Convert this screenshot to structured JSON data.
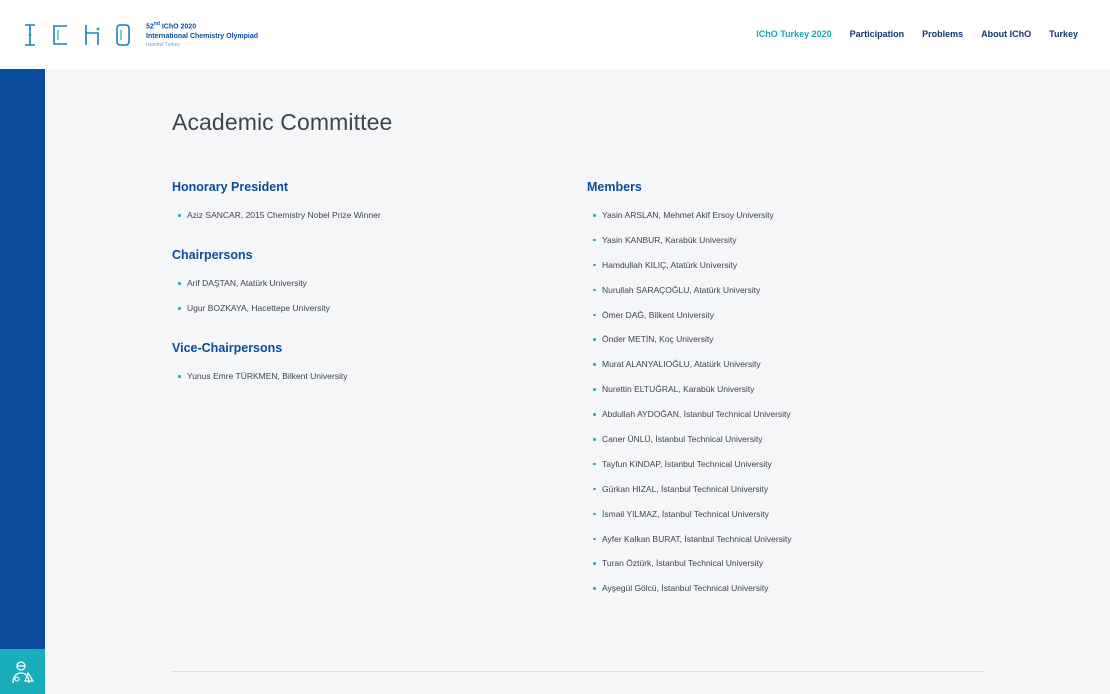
{
  "header": {
    "logo": {
      "letters": [
        "I",
        "C",
        "h",
        "O"
      ],
      "edition": "52",
      "edition_suffix": "nd",
      "event": "IChO 2020",
      "name": "International Chemistry Olympiad",
      "location": "Istanbul Turkey"
    },
    "nav": [
      {
        "label": "IChO Turkey 2020",
        "active": true
      },
      {
        "label": "Participation",
        "active": false
      },
      {
        "label": "Problems",
        "active": false
      },
      {
        "label": "About IChO",
        "active": false
      },
      {
        "label": "Turkey",
        "active": false
      }
    ]
  },
  "main": {
    "title": "Academic Committee",
    "left": [
      {
        "heading": "Honorary President",
        "items": [
          "Aziz SANCAR, 2015 Chemistry Nobel Prize Winner"
        ]
      },
      {
        "heading": "Chairpersons",
        "items": [
          "Arif DAŞTAN, Atatürk University",
          "Ugur BOZKAYA, Hacettepe University"
        ]
      },
      {
        "heading": "Vice-Chairpersons",
        "items": [
          "Yunus Emre TÜRKMEN, Bilkent University"
        ]
      }
    ],
    "right": {
      "heading": "Members",
      "items": [
        "Yasin ARSLAN, Mehmet Akif Ersoy University",
        "Yasin KANBUR, Karabük University",
        "Hamdullah KILIÇ, Atatürk University",
        "Nurullah SARAÇOĞLU, Atatürk University",
        "Ömer DAĞ, Bilkent University",
        "Önder METİN, Koç University",
        "Murat ALANYALIOĞLU, Atatürk University",
        "Nurettin ELTUĞRAL, Karabük University",
        "Abdullah AYDOĞAN, İstanbul Technical University",
        "Caner ÜNLÜ, İstanbul Technical University",
        "Tayfun KINDAP, İstanbul Technical University",
        "Gürkan HIZAL, İstanbul Technical University",
        "İsmail YILMAZ, İstanbul Technical University",
        "Ayfer Kalkan BURAT, İstanbul Technical University",
        "Turan Öztürk, İstanbul Technical University",
        "Ayşegül Gölcü, İstanbul Technical University"
      ]
    }
  },
  "sidebar": {
    "bottom_icon": "scientist-icon"
  },
  "colors": {
    "brand_blue": "#0a4d9c",
    "accent_teal": "#1aaebb",
    "nav_dark": "#12356b"
  }
}
